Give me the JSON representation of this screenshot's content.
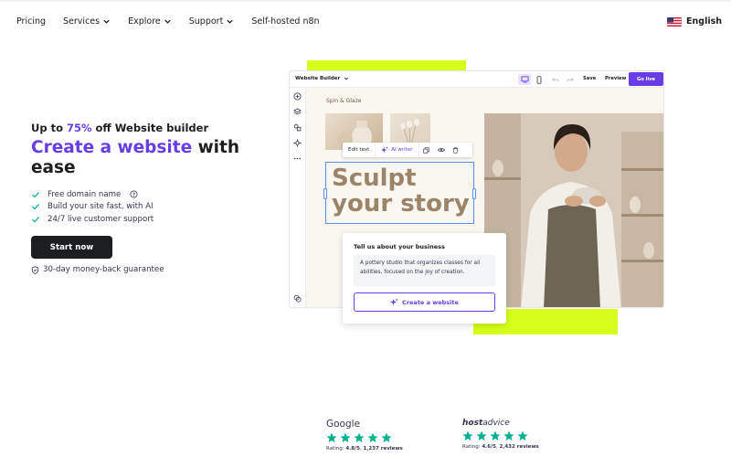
{
  "nav": {
    "items": [
      {
        "label": "Pricing",
        "dropdown": false
      },
      {
        "label": "Services",
        "dropdown": true
      },
      {
        "label": "Explore",
        "dropdown": true
      },
      {
        "label": "Support",
        "dropdown": true
      },
      {
        "label": "Self-hosted n8n",
        "dropdown": false
      }
    ],
    "language": "English"
  },
  "hero": {
    "promo_prefix": "Up to ",
    "promo_percent": "75%",
    "promo_suffix": " off Website builder",
    "headline_accent": "Create a website",
    "headline_rest": " with ease",
    "features": [
      "Free domain name",
      "Build your site fast, with AI",
      "24/7 live customer support"
    ],
    "cta": "Start now",
    "guarantee": "30-day money-back guarantee"
  },
  "builder": {
    "title": "Website Builder",
    "save": "Save",
    "preview": "Preview",
    "go_live": "Go live",
    "brand": "Spin & Glaze",
    "toolbar_edit": "Edit text",
    "toolbar_ai": "AI writer",
    "headline_line1": "Sculpt",
    "headline_line2": "your story"
  },
  "ai_card": {
    "title": "Tell us about your business",
    "description": "A pottery studio that organizes classes for all abilities, focused on the joy of creation.",
    "button": "Create a website"
  },
  "reviews": [
    {
      "source": "Google",
      "rating_label": "Rating: ",
      "rating": "4.8/5",
      "count": "1,237 reviews",
      "stars": 5
    },
    {
      "source_bold": "host",
      "source_light": "advice",
      "rating_label": "Rating: ",
      "rating": "4.6/5",
      "count": "2,432 reviews",
      "stars": 5
    }
  ],
  "colors": {
    "accent": "#673de6",
    "lime": "#d5ff1a",
    "star": "#00b090",
    "check": "#00b090",
    "dark": "#1d1e20"
  }
}
